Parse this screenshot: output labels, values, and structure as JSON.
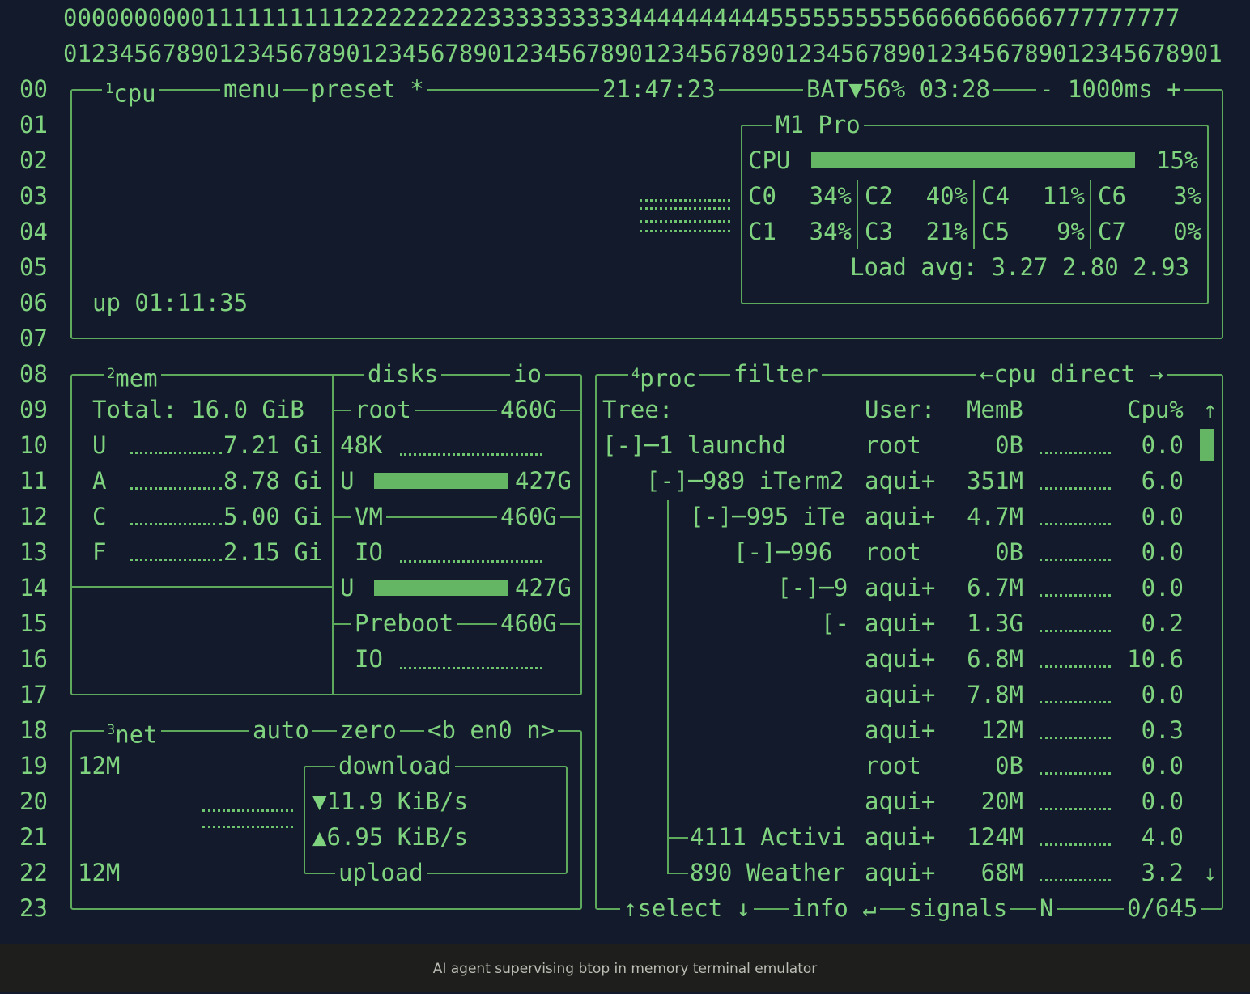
{
  "ruler": {
    "tens": "0000000000111111111122222222223333333333444444444455555555556666666666777777777",
    "ones": "0123456789012345678901234567890123456789012345678901234567890123456789012345678901"
  },
  "row_numbers": [
    "00",
    "01",
    "02",
    "03",
    "04",
    "05",
    "06",
    "07",
    "08",
    "09",
    "10",
    "11",
    "12",
    "13",
    "14",
    "15",
    "16",
    "17",
    "18",
    "19",
    "20",
    "21",
    "22",
    "23"
  ],
  "cpu_box": {
    "tab_num": "1",
    "tab_label": "cpu",
    "menu": "menu",
    "preset": "preset *",
    "clock": "21:47:23",
    "battery": "BAT▼56% 03:28",
    "interval": "- 1000ms +",
    "uptime": "up 01:11:35",
    "chip_name": "M1 Pro",
    "cpu_label": "CPU",
    "cpu_total": "15%",
    "cpu_total_value": 0.15,
    "cores": [
      {
        "name": "C0",
        "pct": "34%"
      },
      {
        "name": "C2",
        "pct": "40%"
      },
      {
        "name": "C4",
        "pct": "11%"
      },
      {
        "name": "C6",
        "pct": "3%"
      },
      {
        "name": "C1",
        "pct": "34%"
      },
      {
        "name": "C3",
        "pct": "21%"
      },
      {
        "name": "C5",
        "pct": "9%"
      },
      {
        "name": "C7",
        "pct": "0%"
      }
    ],
    "load_avg": "Load avg: 3.27 2.80 2.93"
  },
  "mem_box": {
    "tab_num": "2",
    "tab_label": "mem",
    "total": "Total: 16.0 GiB",
    "rows": [
      {
        "key": "U",
        "value": "7.21 Gi"
      },
      {
        "key": "A",
        "value": "8.78 Gi"
      },
      {
        "key": "C",
        "value": "5.00 Gi"
      },
      {
        "key": "F",
        "value": "2.15 Gi"
      }
    ]
  },
  "disks_box": {
    "title": "disks",
    "io": "io",
    "root_name": "root",
    "root_size": "460G",
    "root_io": "48K",
    "root_used_key": "U",
    "root_used": "427G",
    "root_used_fraction": 0.93,
    "vm_name": "VM",
    "vm_size": "460G",
    "vm_io": "IO",
    "vm_used_key": "U",
    "vm_used": "427G",
    "vm_used_fraction": 0.93,
    "preboot_name": "Preboot",
    "preboot_size": "460G",
    "preboot_io": "IO"
  },
  "net_box": {
    "tab_num": "3",
    "tab_label": "net",
    "auto": "auto",
    "zero": "zero",
    "iface": "<b en0 n>",
    "scale_top": "12M",
    "scale_bottom": "12M",
    "download_title": "download",
    "download_rate": "11.9 KiB/s",
    "upload_rate": "6.95 KiB/s",
    "upload_title": "upload"
  },
  "proc_box": {
    "tab_num": "4",
    "tab_label": "proc",
    "filter": "filter",
    "sort": "←cpu direct →",
    "headers": {
      "tree": "Tree:",
      "user": "User:",
      "mem": "MemB",
      "cpu": "Cpu%"
    },
    "rows": [
      {
        "tree": "[-]─1 launchd",
        "indent": 0,
        "user": "root",
        "mem": "0B",
        "cpu": "0.0"
      },
      {
        "tree": "[-]─989 iTerm2",
        "indent": 1,
        "user": "aqui+",
        "mem": "351M",
        "cpu": "6.0"
      },
      {
        "tree": "[-]─995 iTe",
        "indent": 2,
        "user": "aqui+",
        "mem": "4.7M",
        "cpu": "0.0"
      },
      {
        "tree": "[-]─996",
        "indent": 3,
        "user": "root",
        "mem": "0B",
        "cpu": "0.0"
      },
      {
        "tree": "[-]─9",
        "indent": 4,
        "user": "aqui+",
        "mem": "6.7M",
        "cpu": "0.0"
      },
      {
        "tree": "[-",
        "indent": 5,
        "user": "aqui+",
        "mem": "1.3G",
        "cpu": "0.2"
      },
      {
        "tree": "",
        "indent": 5,
        "user": "aqui+",
        "mem": "6.8M",
        "cpu": "10.6"
      },
      {
        "tree": "",
        "indent": 5,
        "user": "aqui+",
        "mem": "7.8M",
        "cpu": "0.0"
      },
      {
        "tree": "",
        "indent": 5,
        "user": "aqui+",
        "mem": "12M",
        "cpu": "0.3"
      },
      {
        "tree": "",
        "indent": 5,
        "user": "root",
        "mem": "0B",
        "cpu": "0.0"
      },
      {
        "tree": "",
        "indent": 5,
        "user": "aqui+",
        "mem": "20M",
        "cpu": "0.0"
      },
      {
        "tree": "4111 Activi",
        "indent": 2,
        "user": "aqui+",
        "mem": "124M",
        "cpu": "4.0"
      },
      {
        "tree": "890 Weather",
        "indent": 2,
        "user": "aqui+",
        "mem": "68M",
        "cpu": "3.2"
      }
    ],
    "footer": {
      "select": "↑select ↓",
      "info": "info ↵",
      "signals": "signals",
      "n": "N",
      "count": "0/645"
    }
  },
  "caption": "AI agent supervising btop in memory terminal emulator"
}
